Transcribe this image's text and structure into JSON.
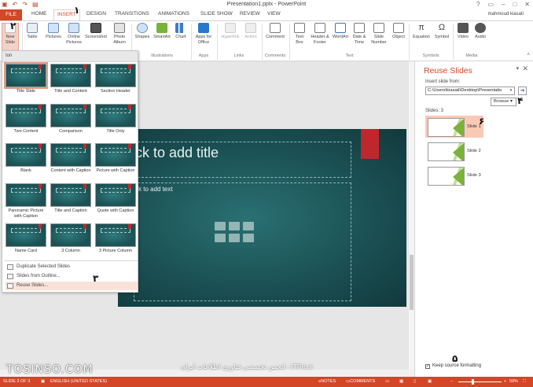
{
  "window": {
    "title": "Presentation1.pptx - PowerPoint",
    "user": "mahmoud kiasati",
    "qat_icons": [
      "save-icon",
      "undo-icon",
      "redo-icon",
      "start-from-beginning-icon"
    ]
  },
  "tabs": [
    "FILE",
    "HOME",
    "INSERT",
    "DESIGN",
    "TRANSITIONS",
    "ANIMATIONS",
    "SLIDE SHOW",
    "REVIEW",
    "VIEW"
  ],
  "active_tab": "INSERT",
  "ribbon": {
    "buttons": {
      "new_slide": "New Slide",
      "table": "Table",
      "pictures": "Pictures",
      "online_pictures": "Online Pictures",
      "screenshot": "Screenshot",
      "photo_album": "Photo Album",
      "shapes": "Shapes",
      "smartart": "SmartArt",
      "chart": "Chart",
      "apps_for_office": "Apps for Office",
      "hyperlink": "Hyperlink",
      "action": "Action",
      "comment": "Comment",
      "text_box": "Text Box",
      "header_footer": "Header & Footer",
      "wordart": "WordArt",
      "date_time": "Date & Time",
      "slide_number": "Slide Number",
      "object": "Object",
      "equation": "Equation",
      "symbol": "Symbol",
      "video": "Video",
      "audio": "Audio"
    },
    "groups": {
      "illustrations": "Illustrations",
      "apps": "Apps",
      "links": "Links",
      "comments": "Comments",
      "text": "Text",
      "symbols": "Symbols",
      "media": "Media"
    }
  },
  "layout_menu": {
    "header": "Ion",
    "layouts": [
      "Title Slide",
      "Title and Content",
      "Section Header",
      "Two Content",
      "Comparison",
      "Title Only",
      "Blank",
      "Content with Caption",
      "Picture with Caption",
      "Panoramic Picture with Caption",
      "Title and Caption",
      "Quote with Caption",
      "Name Card",
      "3 Column",
      "3 Picture Column"
    ],
    "items": {
      "duplicate": "Duplicate Selected Slides",
      "outline": "Slides from Outline...",
      "reuse": "Reuse Slides..."
    }
  },
  "slide": {
    "title_placeholder": "ck to add title",
    "body_placeholder": "ck to add text"
  },
  "reuse_pane": {
    "title": "Reuse Slides",
    "insert_from_label": "Insert slide from:",
    "path_value": "C:\\Users\\kiasati\\Desktop\\Presentatio",
    "browse_label": "Browse",
    "slides_count": "Slides: 3",
    "slides": [
      "Slide 1",
      "Slide 2",
      "Slide 3"
    ],
    "keep_source": "Keep source formatting",
    "keep_source_checked": true
  },
  "status": {
    "slide_of": "SLIDE 3 OF 3",
    "language": "ENGLISH (UNITED STATES)",
    "notes": "NOTES",
    "comments": "COMMENTS",
    "zoom": "59%"
  },
  "annotations": [
    "۱",
    "۲",
    "۳",
    "۴",
    "۵",
    "۶"
  ],
  "watermark": {
    "left": "TOSINSO.COM",
    "center": "انجمن تخصصی فناوری اطلاعات ایران - ITPro.ir"
  },
  "colors": {
    "accent": "#d24726",
    "slide_bg": "#1b5154",
    "slide_red": "#c0272d",
    "thumb_green": "#7ab23a"
  }
}
